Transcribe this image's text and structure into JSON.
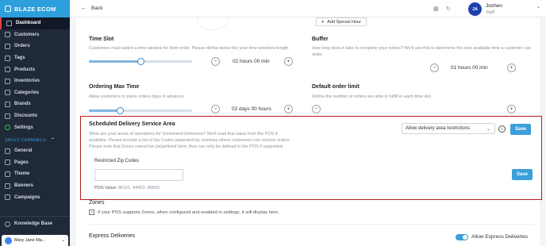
{
  "brand": {
    "name": "BLAZE ECOM"
  },
  "sidebar": {
    "items": [
      {
        "label": "Dashboard",
        "icon": "dashboard-icon",
        "active": true
      },
      {
        "label": "Customers",
        "icon": "customers-icon"
      },
      {
        "label": "Orders",
        "icon": "orders-icon"
      },
      {
        "label": "Tags",
        "icon": "tag-icon"
      },
      {
        "label": "Products",
        "icon": "products-icon"
      },
      {
        "label": "Inventories",
        "icon": "inventory-icon"
      },
      {
        "label": "Categories",
        "icon": "categories-icon"
      },
      {
        "label": "Brands",
        "icon": "brands-icon"
      },
      {
        "label": "Discounts",
        "icon": "discount-icon"
      },
      {
        "label": "Settings",
        "icon": "gear-icon"
      }
    ],
    "section_label": "SALES CHANNELS",
    "channels": [
      {
        "label": "General",
        "icon": "globe-icon"
      },
      {
        "label": "Pages",
        "icon": "pages-icon"
      },
      {
        "label": "Theme",
        "icon": "theme-icon"
      },
      {
        "label": "Banners",
        "icon": "banner-icon"
      },
      {
        "label": "Campaigns",
        "icon": "campaign-icon"
      }
    ],
    "knowledge_base": "Knowledge Base",
    "user_name": "Mary Jane Ma..."
  },
  "topbar": {
    "back_label": "Back",
    "avatar_initials": "JA",
    "user_name": "Jochen",
    "user_role": "Staff"
  },
  "special_hour": {
    "label": "Add Special Hour"
  },
  "time_slot": {
    "title": "Time Slot",
    "desc": "Customers must select a time window for their order. Please define below the your time windows length.",
    "value": "02 hours 00 min",
    "slider_fraction": 0.5
  },
  "buffer": {
    "title": "Buffer",
    "desc": "How long does it take to complete your orders? We'll use this to determine the next available time a customer can order.",
    "value": "01 hours 00 min"
  },
  "ordering_max": {
    "title": "Ordering Max Time",
    "desc": "Allow customers to place orders days in advance.",
    "value": "02 days 00 hours",
    "slider_fraction": 0.3
  },
  "order_limit": {
    "title": "Default order limit",
    "desc": "Define the number of orders are able to fulfill in each time slot."
  },
  "scheduled_area": {
    "title": "Scheduled Delivery Service Area",
    "desc1": "What are your areas of operations for Scheduled Deliveries? We'll read that value from the POS if",
    "desc2": "available. Please provide a list of Zip Codes separated by commas where customers can receive orders.",
    "desc3": "Please note that Zones cannot be (re)defined here; they can only be defined in the POS if supported.",
    "select_value": "Allow delivery area restrictions",
    "save_label": "Save",
    "zip_label": "Restricted Zip Codes",
    "zip_value": "",
    "zip_save_label": "Save",
    "pos_value_label": "POS Value:",
    "pos_value": "96161, 94903, 89503"
  },
  "zones": {
    "title": "Zones",
    "checkbox_label": "If your POS supports Zones, when configured and enabled in settings, it will display here."
  },
  "express": {
    "title": "Express Deliveries",
    "toggle_label": "Allow Express Deliveries",
    "toggle_on": true
  }
}
